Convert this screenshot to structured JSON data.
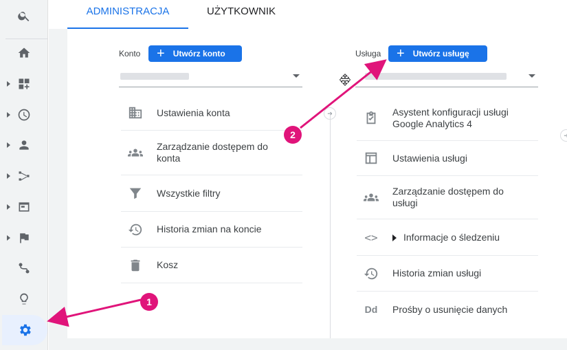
{
  "tabs": {
    "admin": "ADMINISTRACJA",
    "user": "UŻYTKOWNIK"
  },
  "account": {
    "label": "Konto",
    "create_button": "Utwórz konto",
    "items": [
      {
        "label": "Ustawienia konta",
        "icon": "building-icon"
      },
      {
        "label": "Zarządzanie dostępem do konta",
        "icon": "people-icon"
      },
      {
        "label": "Wszystkie filtry",
        "icon": "filter-icon"
      },
      {
        "label": "Historia zmian na koncie",
        "icon": "history-icon"
      },
      {
        "label": "Kosz",
        "icon": "trash-icon"
      }
    ]
  },
  "property": {
    "label": "Usługa",
    "create_button": "Utwórz usługę",
    "items": [
      {
        "label": "Asystent konfiguracji usługi Google Analytics 4",
        "icon": "clipboard-check-icon"
      },
      {
        "label": "Ustawienia usługi",
        "icon": "layout-icon"
      },
      {
        "label": "Zarządzanie dostępem do usługi",
        "icon": "people-icon"
      },
      {
        "label": "Informacje o śledzeniu",
        "icon": "code-icon"
      },
      {
        "label": "Historia zmian usługi",
        "icon": "history-icon"
      },
      {
        "label": "Prośby o usunięcie danych",
        "icon": "dd-icon"
      }
    ]
  },
  "annotations": {
    "badge1": "1",
    "badge2": "2"
  },
  "code_icon_glyph": "<>",
  "dd_icon_glyph": "Dd",
  "colors": {
    "accent": "#1a73e8",
    "annotation": "#e0147a"
  }
}
